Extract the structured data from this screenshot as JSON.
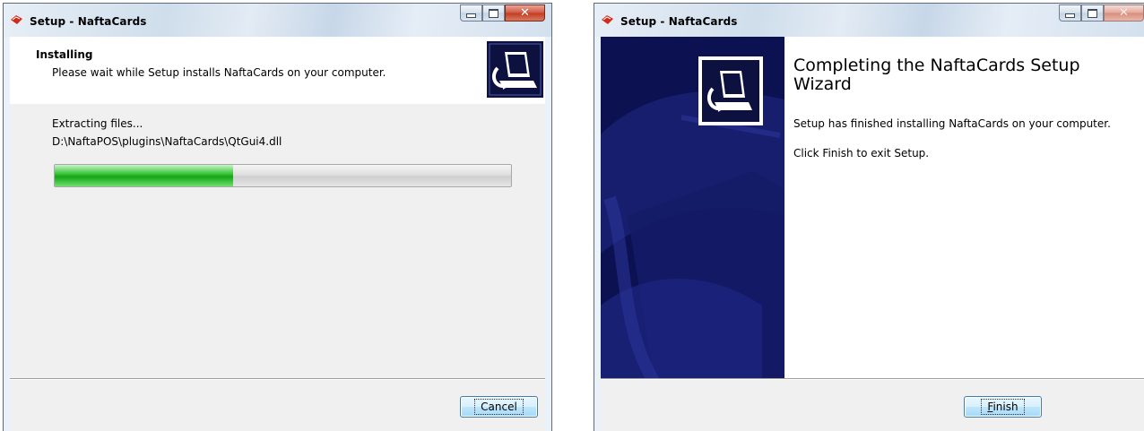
{
  "window1": {
    "title": "Setup - NaftaCards",
    "header_title": "Installing",
    "header_subtitle": "Please wait while Setup installs NaftaCards on your computer.",
    "status": "Extracting files...",
    "detail": "D:\\NaftaPOS\\plugins\\NaftaCards\\QtGui4.dll",
    "progress_fraction": 0.39,
    "cancel_label": "Cancel"
  },
  "window2": {
    "title": "Setup - NaftaCards",
    "heading": "Completing the NaftaCards Setup Wizard",
    "text1": "Setup has finished installing NaftaCards on your computer.",
    "text2": "Click Finish to exit Setup.",
    "finish_label": "Finish"
  },
  "icons": {
    "app": "setup-app-icon",
    "wizard": "computer-install-icon"
  },
  "colors": {
    "accent_green": "#22b022",
    "wizard_panel": "#0c1152",
    "close_red": "#c23b22"
  }
}
